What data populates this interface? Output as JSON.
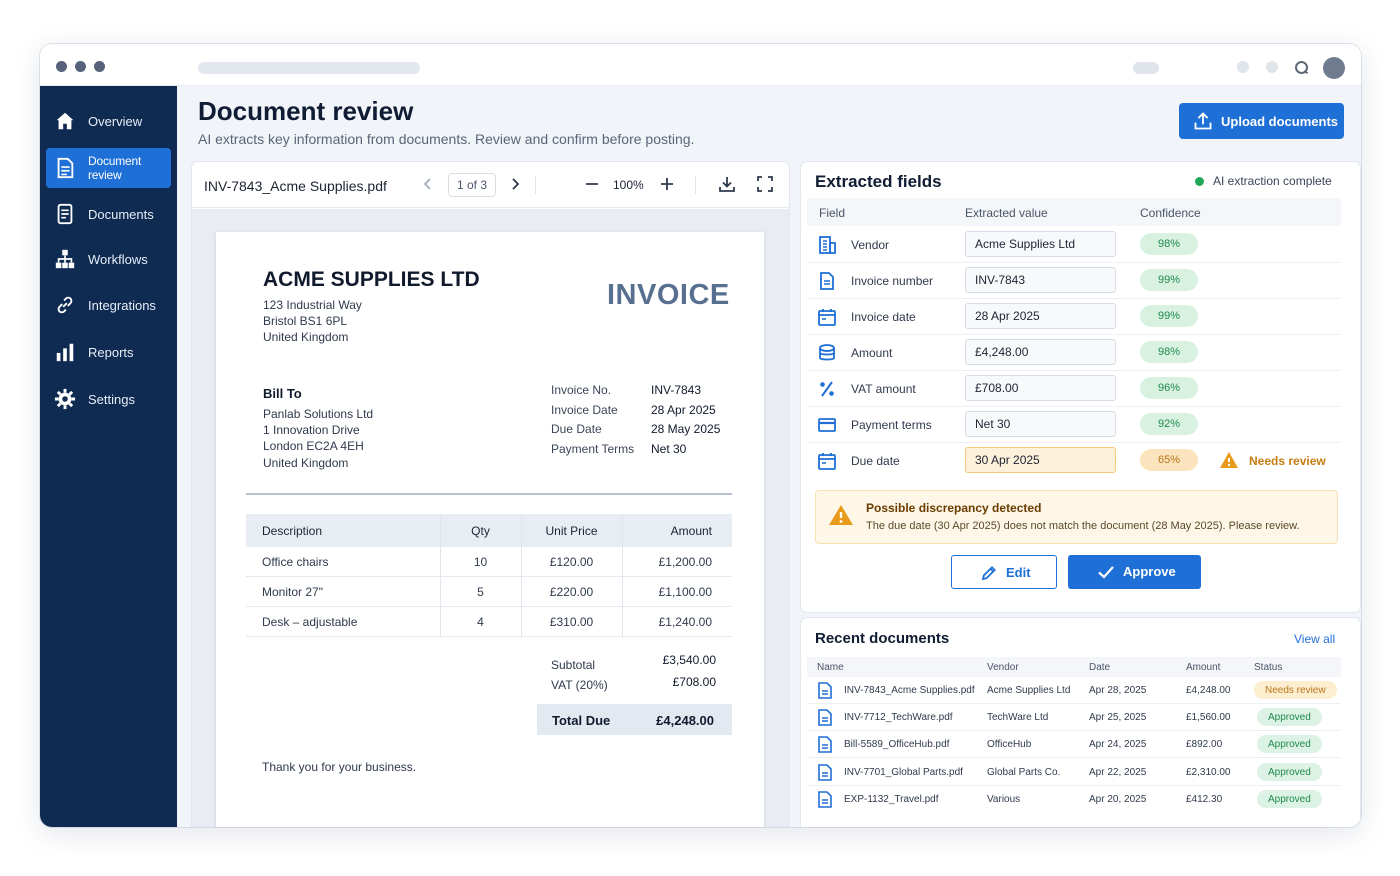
{
  "nav": [
    {
      "label": "Overview",
      "icon": "home-icon"
    },
    {
      "label": "Document review",
      "icon": "document-icon"
    },
    {
      "label": "Documents",
      "icon": "documents-icon"
    },
    {
      "label": "Workflows",
      "icon": "workflow-icon"
    },
    {
      "label": "Integrations",
      "icon": "link-icon"
    },
    {
      "label": "Reports",
      "icon": "bar-chart-icon"
    },
    {
      "label": "Settings",
      "icon": "gear-icon"
    }
  ],
  "header": {
    "title": "Document review",
    "subtitle": "AI extracts key information from documents. Review and confirm before posting.",
    "upload_label": "Upload documents"
  },
  "viewer": {
    "file_name": "INV-7843_Acme Supplies.pdf",
    "page_indicator": "1 of 3",
    "zoom": "100%"
  },
  "invoice": {
    "company": "ACME SUPPLIES LTD",
    "address": [
      "123 Industrial Way",
      "Bristol BS1 6PL",
      "United Kingdom"
    ],
    "doc_type": "INVOICE",
    "bill_to_label": "Bill To",
    "bill_to": [
      "Panlab Solutions Ltd",
      "1 Innovation Drive",
      "London EC2A 4EH",
      "United Kingdom"
    ],
    "meta": [
      {
        "label": "Invoice No.",
        "value": "INV-7843"
      },
      {
        "label": "Invoice Date",
        "value": "28 Apr 2025"
      },
      {
        "label": "Due Date",
        "value": "28 May 2025"
      },
      {
        "label": "Payment Terms",
        "value": "Net 30"
      }
    ],
    "columns": [
      "Description",
      "Qty",
      "Unit Price",
      "Amount"
    ],
    "lines": [
      {
        "description": "Office chairs",
        "qty": "10",
        "unit_price": "£120.00",
        "amount": "£1,200.00"
      },
      {
        "description": "Monitor 27\"",
        "qty": "5",
        "unit_price": "£220.00",
        "amount": "£1,100.00"
      },
      {
        "description": "Desk – adjustable",
        "qty": "4",
        "unit_price": "£310.00",
        "amount": "£1,240.00"
      }
    ],
    "subtotal_label": "Subtotal",
    "subtotal": "£3,540.00",
    "vat_label": "VAT (20%)",
    "vat": "£708.00",
    "total_label": "Total Due",
    "total": "£4,248.00",
    "thanks": "Thank you for your business."
  },
  "fields": {
    "title": "Extracted fields",
    "status": "AI extraction complete",
    "columns": [
      "Field",
      "Extracted value",
      "Confidence"
    ],
    "rows": [
      {
        "label": "Vendor",
        "value": "Acme Supplies Ltd",
        "confidence": "98%",
        "icon": "building-icon"
      },
      {
        "label": "Invoice number",
        "value": "INV-7843",
        "confidence": "99%",
        "icon": "document-icon"
      },
      {
        "label": "Invoice date",
        "value": "28 Apr 2025",
        "confidence": "99%",
        "icon": "calendar-icon"
      },
      {
        "label": "Amount",
        "value": "£4,248.00",
        "confidence": "98%",
        "icon": "coins-icon"
      },
      {
        "label": "VAT amount",
        "value": "£708.00",
        "confidence": "96%",
        "icon": "percent-icon"
      },
      {
        "label": "Payment terms",
        "value": "Net 30",
        "confidence": "92%",
        "icon": "card-icon"
      },
      {
        "label": "Due date",
        "value": "30 Apr 2025",
        "confidence": "65%",
        "icon": "calendar-icon",
        "flag": "Needs review"
      }
    ],
    "alert_title": "Possible discrepancy detected",
    "alert_message": "The due date (30 Apr 2025) does not match the document (28 May 2025). Please review.",
    "edit_label": "Edit",
    "approve_label": "Approve"
  },
  "recent": {
    "title": "Recent documents",
    "view_all": "View all",
    "columns": [
      "Name",
      "Vendor",
      "Date",
      "Amount",
      "Status"
    ],
    "rows": [
      {
        "name": "INV-7843_Acme Supplies.pdf",
        "vendor": "Acme Supplies Ltd",
        "date": "Apr 28, 2025",
        "amount": "£4,248.00",
        "status": "Needs review"
      },
      {
        "name": "INV-7712_TechWare.pdf",
        "vendor": "TechWare Ltd",
        "date": "Apr 25, 2025",
        "amount": "£1,560.00",
        "status": "Approved"
      },
      {
        "name": "Bill-5589_OfficeHub.pdf",
        "vendor": "OfficeHub",
        "date": "Apr 24, 2025",
        "amount": "£892.00",
        "status": "Approved"
      },
      {
        "name": "INV-7701_Global Parts.pdf",
        "vendor": "Global Parts Co.",
        "date": "Apr 22, 2025",
        "amount": "£2,310.00",
        "status": "Approved"
      },
      {
        "name": "EXP-1132_Travel.pdf",
        "vendor": "Various",
        "date": "Apr 20, 2025",
        "amount": "£412.30",
        "status": "Approved"
      }
    ]
  },
  "colors": {
    "sidebar": "#0f2b52",
    "accent": "#1e6fd6",
    "success": "#1f8a4c",
    "warning": "#c67c12"
  }
}
